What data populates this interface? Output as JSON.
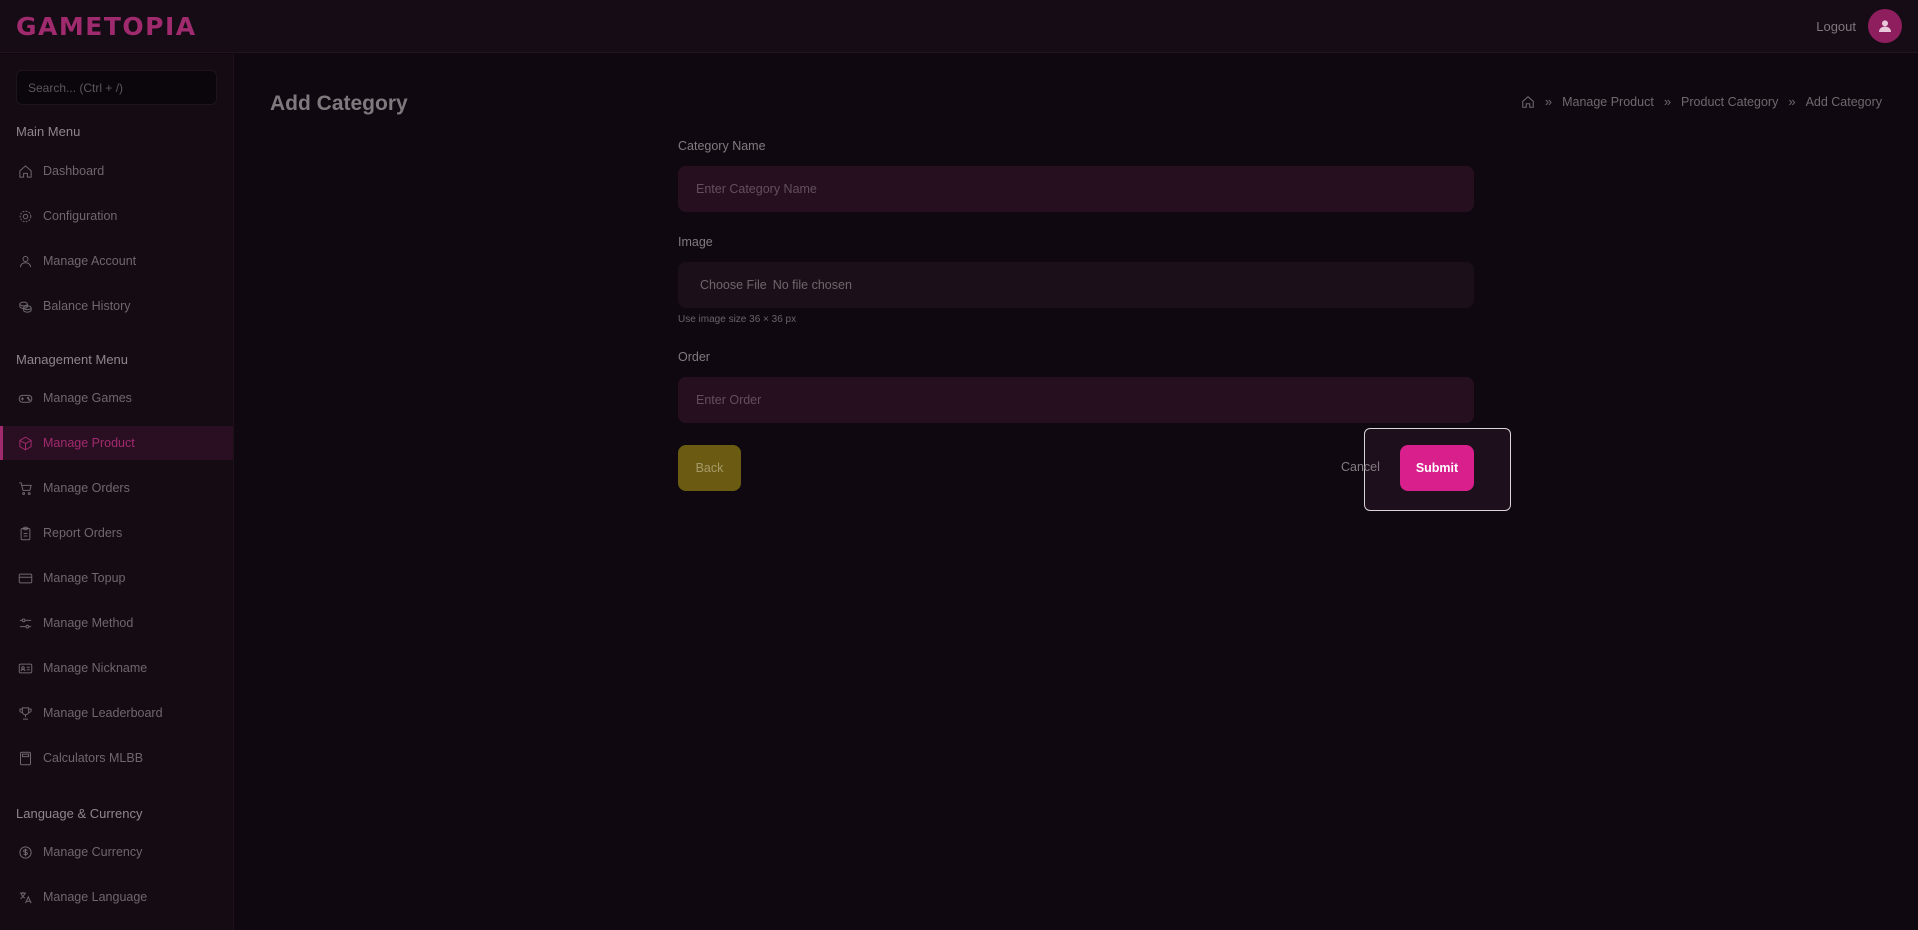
{
  "brand": {
    "logo": "GAMETOPIA"
  },
  "header": {
    "logout": "Logout"
  },
  "sidebar": {
    "search_placeholder": "Search... (Ctrl + /)",
    "sections": [
      {
        "title": "Main Menu",
        "items": [
          {
            "label": "Dashboard",
            "icon": "home-icon"
          },
          {
            "label": "Configuration",
            "icon": "gear-icon"
          },
          {
            "label": "Manage Account",
            "icon": "user-icon"
          },
          {
            "label": "Balance History",
            "icon": "coins-icon"
          }
        ]
      },
      {
        "title": "Management Menu",
        "items": [
          {
            "label": "Manage Games",
            "icon": "gamepad-icon"
          },
          {
            "label": "Manage Product",
            "icon": "box-icon",
            "active": true
          },
          {
            "label": "Manage Orders",
            "icon": "cart-icon"
          },
          {
            "label": "Report Orders",
            "icon": "clipboard-icon"
          },
          {
            "label": "Manage Topup",
            "icon": "card-icon"
          },
          {
            "label": "Manage Method",
            "icon": "sliders-icon"
          },
          {
            "label": "Manage Nickname",
            "icon": "id-card-icon"
          },
          {
            "label": "Manage Leaderboard",
            "icon": "trophy-icon"
          },
          {
            "label": "Calculators MLBB",
            "icon": "calculator-icon"
          }
        ]
      },
      {
        "title": "Language & Currency",
        "items": [
          {
            "label": "Manage Currency",
            "icon": "dollar-icon"
          },
          {
            "label": "Manage Language",
            "icon": "translate-icon"
          }
        ]
      }
    ]
  },
  "main": {
    "title": "Add Category",
    "breadcrumb": [
      "Manage Product",
      "Product Category",
      "Add Category"
    ],
    "form": {
      "category_name_label": "Category Name",
      "category_name_placeholder": "Enter Category Name",
      "image_label": "Image",
      "file_button": "Choose File",
      "file_status": "No file chosen",
      "image_hint": "Use image size 36 × 36 px",
      "order_label": "Order",
      "order_placeholder": "Enter Order",
      "back": "Back",
      "cancel": "Cancel",
      "submit": "Submit"
    }
  },
  "colors": {
    "accent": "#d81f8c",
    "brand": "#a02a6e",
    "back_button": "#6b5b12"
  }
}
